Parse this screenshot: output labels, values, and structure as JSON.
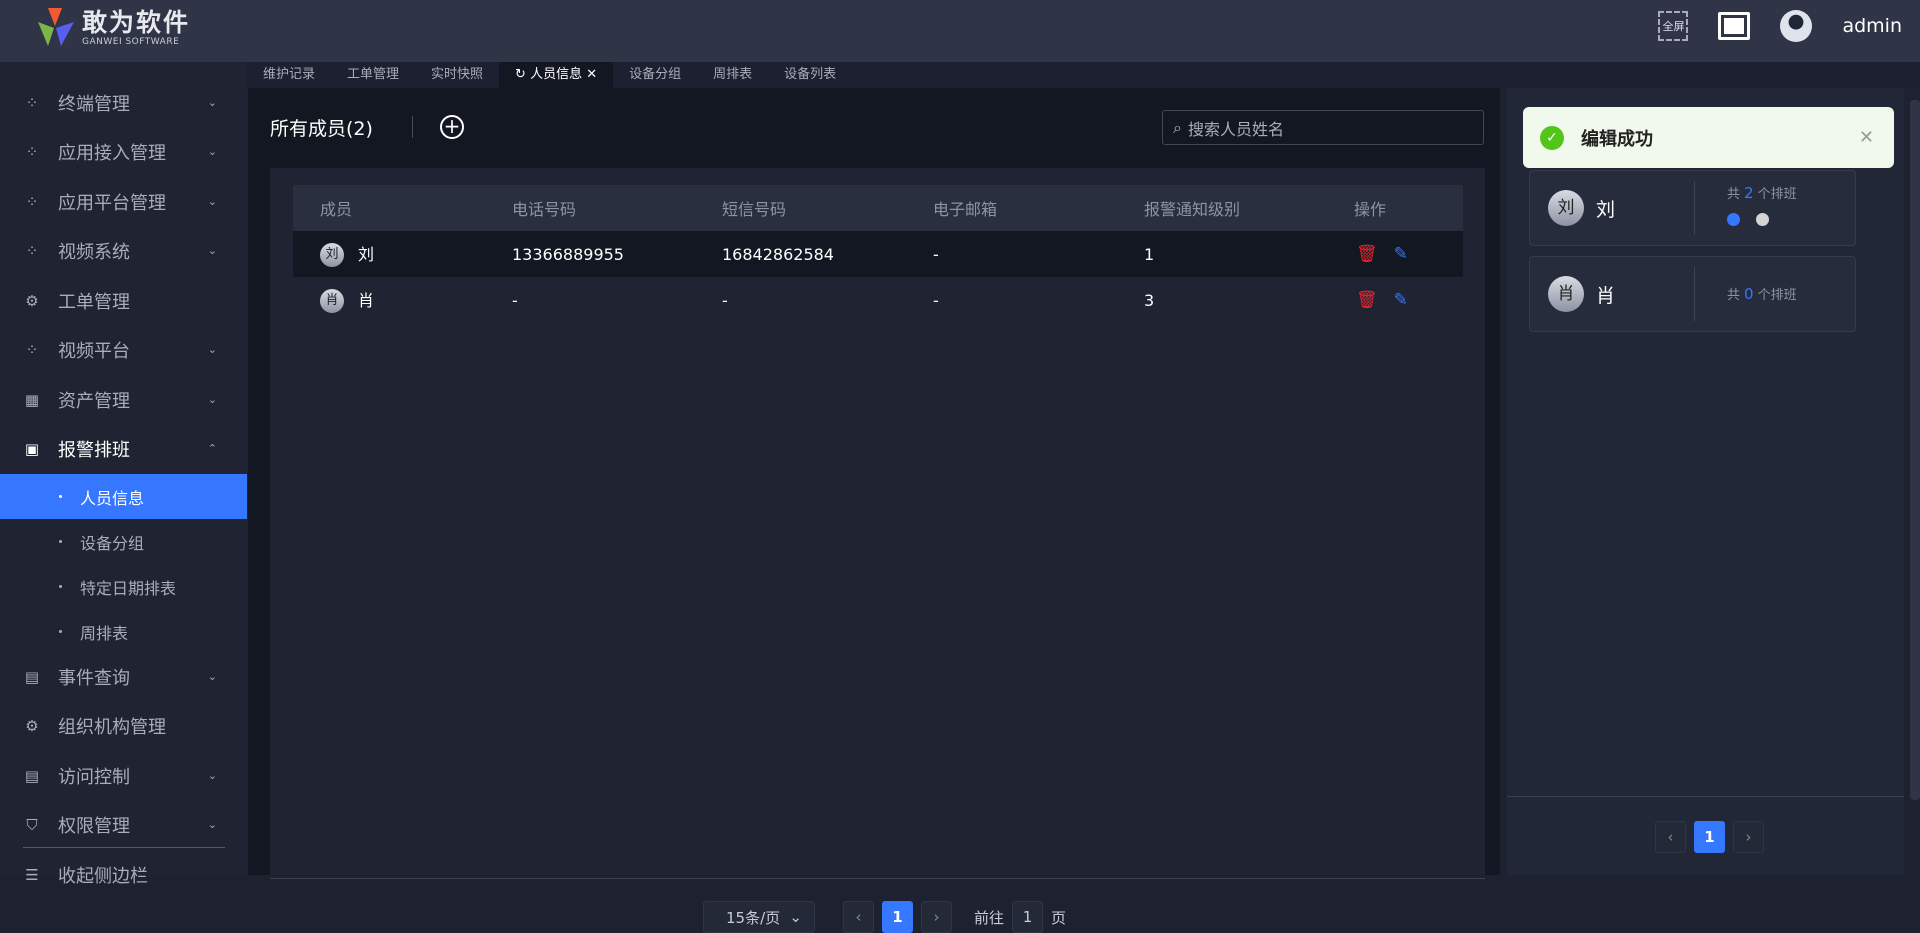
{
  "header": {
    "logo_title": "敢为软件",
    "logo_subtitle": "GANWEI SOFTWARE",
    "fullscreen_label": "全屏",
    "username": "admin"
  },
  "sidebar": {
    "items": [
      {
        "label": "终端管理",
        "icon": "grid-icon",
        "chevron": "down"
      },
      {
        "label": "应用接入管理",
        "icon": "grid-icon",
        "chevron": "down"
      },
      {
        "label": "应用平台管理",
        "icon": "grid-icon",
        "chevron": "down"
      },
      {
        "label": "视频系统",
        "icon": "grid-icon",
        "chevron": "down"
      },
      {
        "label": "工单管理",
        "icon": "gear-icon"
      },
      {
        "label": "视频平台",
        "icon": "grid-icon",
        "chevron": "down"
      },
      {
        "label": "资产管理",
        "icon": "building-icon",
        "chevron": "down"
      },
      {
        "label": "报警排班",
        "icon": "calendar-icon",
        "chevron": "up"
      }
    ],
    "subitems": [
      "人员信息",
      "设备分组",
      "特定日期排表",
      "周排表"
    ],
    "items_after": [
      {
        "label": "事件查询",
        "icon": "document-search-icon",
        "chevron": "down"
      },
      {
        "label": "组织机构管理",
        "icon": "gear-icon"
      },
      {
        "label": "访问控制",
        "icon": "receipt-icon",
        "chevron": "down"
      },
      {
        "label": "权限管理",
        "icon": "shield-icon",
        "chevron": "down"
      }
    ],
    "collapse_label": "收起侧边栏"
  },
  "tabs": [
    "维护记录",
    "工单管理",
    "实时快照",
    "人员信息",
    "设备分组",
    "周排表",
    "设备列表"
  ],
  "main": {
    "title": "所有成员(2)",
    "search_placeholder": "搜索人员姓名",
    "columns": [
      "成员",
      "电话号码",
      "短信号码",
      "电子邮箱",
      "报警通知级别",
      "操作"
    ],
    "rows": [
      {
        "avatar": "刘",
        "name": "刘",
        "phone": "13366889955",
        "sms": "16842862584",
        "email": "-",
        "level": "1"
      },
      {
        "avatar": "肖",
        "name": "肖",
        "phone": "-",
        "sms": "-",
        "email": "-",
        "level": "3"
      }
    ],
    "pagination": {
      "page_size": "15条/页",
      "current": "1",
      "goto_label": "前往",
      "goto_value": "1",
      "page_suffix": "页"
    }
  },
  "right": {
    "cards": [
      {
        "avatar": "刘",
        "name": "刘",
        "prefix": "共",
        "count": "2",
        "suffix": "个排班"
      },
      {
        "avatar": "肖",
        "name": "肖",
        "prefix": "共",
        "count": "0",
        "suffix": "个排班"
      }
    ],
    "pagination_current": "1"
  },
  "toast": {
    "message": "编辑成功"
  },
  "colors": {
    "accent": "#3677ff",
    "success": "#52c41a",
    "danger": "#e8262d"
  }
}
